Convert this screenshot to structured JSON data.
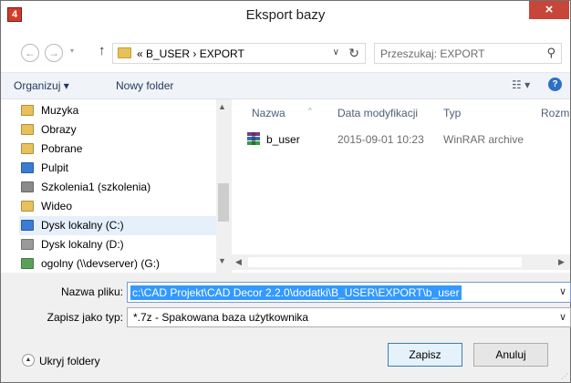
{
  "window": {
    "title": "Eksport bazy",
    "close_glyph": "×",
    "app_icon_glyph": "4"
  },
  "navigation": {
    "back_glyph": "←",
    "forward_glyph": "→",
    "history_glyph": "▾",
    "up_glyph": "↑",
    "breadcrumb": "«  B_USER  ›  EXPORT",
    "addr_dropdown_glyph": "∨",
    "refresh_glyph": "↻",
    "search_placeholder": "Przeszukaj: EXPORT",
    "search_glyph": "⚲"
  },
  "toolbar": {
    "organize_label": "Organizuj ▾",
    "new_folder_label": "Nowy folder",
    "view_glyph": "☷ ▾",
    "help_glyph": "?"
  },
  "nav_items": [
    {
      "label": "Muzyka",
      "icon": "music-folder-icon",
      "color": "#e8c15a"
    },
    {
      "label": "Obrazy",
      "icon": "pictures-folder-icon",
      "color": "#e8c15a"
    },
    {
      "label": "Pobrane",
      "icon": "downloads-folder-icon",
      "color": "#e8c15a"
    },
    {
      "label": "Pulpit",
      "icon": "desktop-folder-icon",
      "color": "#3a7bd5"
    },
    {
      "label": "Szkolenia1 (szkolenia)",
      "icon": "network-computer-icon",
      "color": "#8a8a8a"
    },
    {
      "label": "Wideo",
      "icon": "videos-folder-icon",
      "color": "#e8c15a"
    },
    {
      "label": "Dysk lokalny (C:)",
      "icon": "local-disk-icon",
      "color": "#3a7bd5"
    },
    {
      "label": "Dysk lokalny (D:)",
      "icon": "local-disk-icon",
      "color": "#9a9a9a"
    },
    {
      "label": "ogolny (\\\\devserver) (G:)",
      "icon": "network-drive-icon",
      "color": "#5aa05a"
    }
  ],
  "selected_nav_index": 6,
  "columns": [
    "Nazwa",
    "Data modyfikacji",
    "Typ",
    "Rozm"
  ],
  "files": [
    {
      "name": "b_user",
      "modified": "2015-09-01 10:23",
      "type": "WinRAR archive"
    }
  ],
  "scroll_glyphs": {
    "up": "▲",
    "down": "▼",
    "left": "◀",
    "right": "▶"
  },
  "form": {
    "filename_label": "Nazwa pliku:",
    "filename_value": "c:\\CAD Projekt\\CAD Decor 2.2.0\\dodatki\\B_USER\\EXPORT\\b_user",
    "filetype_label": "Zapisz jako typ:",
    "filetype_value": "*.7z - Spakowana baza użytkownika",
    "dropdown_glyph": "∨"
  },
  "footer": {
    "hide_folders_label": "Ukryj foldery",
    "hide_folders_glyph": "▲",
    "save_label": "Zapisz",
    "cancel_label": "Anuluj",
    "grip_glyph": "⋰"
  }
}
